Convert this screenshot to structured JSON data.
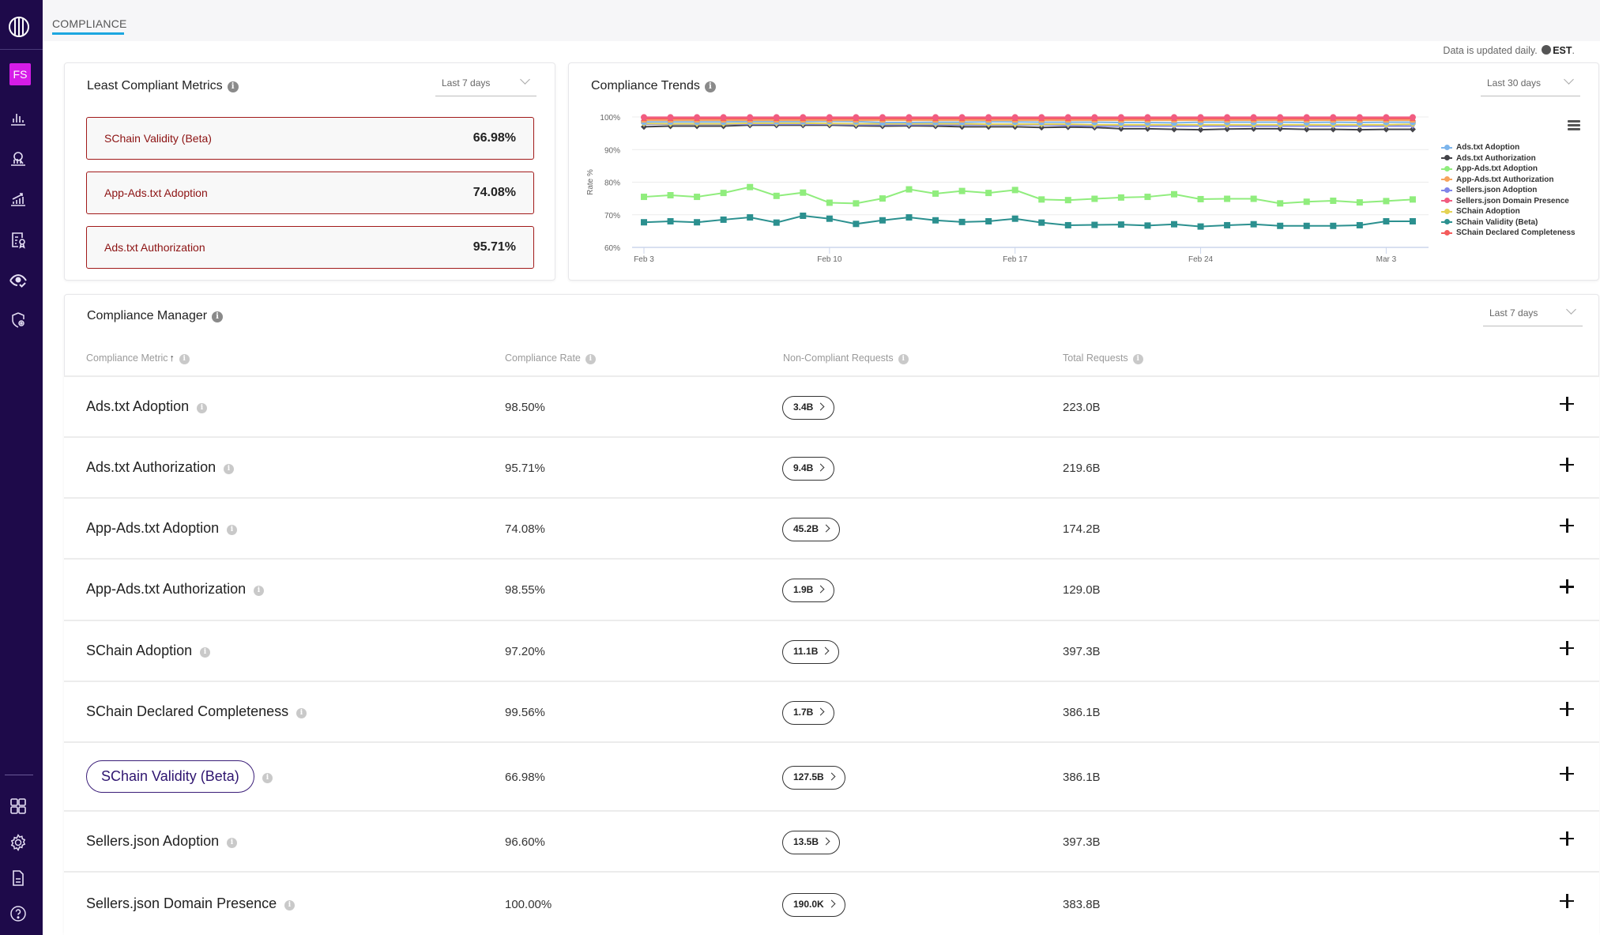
{
  "sidebar": {
    "avatar_initials": "FS",
    "items": [
      {
        "icon": "bar-chart-icon"
      },
      {
        "icon": "audience-icon"
      },
      {
        "icon": "growth-chart-icon"
      },
      {
        "icon": "certificate-icon"
      },
      {
        "icon": "eye-check-icon"
      },
      {
        "icon": "shield-gear-icon"
      }
    ],
    "bottom_items": [
      {
        "icon": "grid-icon"
      },
      {
        "icon": "gear-icon"
      },
      {
        "icon": "document-icon"
      },
      {
        "icon": "help-icon"
      }
    ]
  },
  "header": {
    "active_tab": "COMPLIANCE",
    "update_note_prefix": "Data is updated daily.",
    "timezone": "EST",
    "update_note_suffix": "."
  },
  "least_compliant": {
    "title": "Least Compliant Metrics",
    "range": "Last 7 days",
    "items": [
      {
        "name": "SChain Validity (Beta)",
        "value": "66.98%"
      },
      {
        "name": "App-Ads.txt Adoption",
        "value": "74.08%"
      },
      {
        "name": "Ads.txt Authorization",
        "value": "95.71%"
      }
    ]
  },
  "trends": {
    "title": "Compliance Trends",
    "range": "Last 30 days"
  },
  "chart_data": {
    "type": "line",
    "title": "Compliance Trends",
    "xlabel": "",
    "ylabel": "Rate %",
    "ylim": [
      60,
      100
    ],
    "yticks": [
      "60%",
      "70%",
      "80%",
      "90%",
      "100%"
    ],
    "xtick_labels": [
      {
        "index": 0,
        "label": "Feb 3"
      },
      {
        "index": 7,
        "label": "Feb 10"
      },
      {
        "index": 14,
        "label": "Feb 17"
      },
      {
        "index": 21,
        "label": "Feb 24"
      },
      {
        "index": 28,
        "label": "Mar 3"
      }
    ],
    "x": [
      "Feb 3",
      "Feb 4",
      "Feb 5",
      "Feb 6",
      "Feb 7",
      "Feb 8",
      "Feb 9",
      "Feb 10",
      "Feb 11",
      "Feb 12",
      "Feb 13",
      "Feb 14",
      "Feb 15",
      "Feb 16",
      "Feb 17",
      "Feb 18",
      "Feb 19",
      "Feb 20",
      "Feb 21",
      "Feb 22",
      "Feb 23",
      "Feb 24",
      "Feb 25",
      "Feb 26",
      "Feb 27",
      "Feb 28",
      "Mar 1",
      "Mar 2",
      "Mar 3",
      "Mar 4"
    ],
    "grid": true,
    "legend_position": "right",
    "series": [
      {
        "name": "Ads.txt Adoption",
        "color": "#7cb5ec",
        "marker": "circle",
        "values": [
          98.5,
          98.5,
          98.5,
          98.5,
          98.6,
          98.6,
          98.6,
          98.7,
          98.6,
          98.3,
          98.3,
          98.4,
          98.4,
          98.5,
          98.5,
          98.4,
          98.4,
          98.4,
          98.3,
          98.3,
          98.2,
          98.4,
          98.4,
          98.4,
          98.4,
          98.3,
          98.4,
          98.3,
          98.4,
          98.4
        ]
      },
      {
        "name": "Ads.txt Authorization",
        "color": "#434348",
        "marker": "diamond",
        "values": [
          97.0,
          97.2,
          97.2,
          97.2,
          97.5,
          97.5,
          97.5,
          97.5,
          97.3,
          97.2,
          97.3,
          97.2,
          97.0,
          97.0,
          97.0,
          96.8,
          96.9,
          96.8,
          96.4,
          96.4,
          96.2,
          96.1,
          96.3,
          96.4,
          96.4,
          96.2,
          96.2,
          96.1,
          96.2,
          96.2
        ]
      },
      {
        "name": "App-Ads.txt Adoption",
        "color": "#90ed7d",
        "marker": "square",
        "values": [
          75.5,
          76.0,
          75.5,
          76.7,
          78.5,
          75.8,
          76.8,
          73.7,
          73.5,
          75.0,
          77.8,
          76.5,
          77.3,
          76.7,
          77.6,
          74.7,
          74.5,
          74.9,
          75.3,
          75.5,
          76.3,
          74.8,
          74.9,
          74.9,
          73.5,
          74.0,
          74.3,
          73.8,
          74.2,
          74.7
        ]
      },
      {
        "name": "App-Ads.txt Authorization",
        "color": "#f7a35c",
        "marker": "triangle",
        "values": [
          99.0,
          99.0,
          99.0,
          99.0,
          99.0,
          99.0,
          99.0,
          99.0,
          99.0,
          99.0,
          99.0,
          99.0,
          99.0,
          99.0,
          99.0,
          99.0,
          99.0,
          99.0,
          99.0,
          99.0,
          99.0,
          99.0,
          99.0,
          99.0,
          99.0,
          99.0,
          99.0,
          99.0,
          99.0,
          99.0
        ]
      },
      {
        "name": "Sellers.json Adoption",
        "color": "#8085e9",
        "marker": "triangle-down",
        "values": [
          97.8,
          97.8,
          97.8,
          97.8,
          97.8,
          97.8,
          97.8,
          97.8,
          97.6,
          97.6,
          97.6,
          97.6,
          97.6,
          97.6,
          97.6,
          97.6,
          97.4,
          97.2,
          97.2,
          97.2,
          97.2,
          97.2,
          97.2,
          97.2,
          97.2,
          97.2,
          97.2,
          97.2,
          97.2,
          97.2
        ]
      },
      {
        "name": "Sellers.json Domain Presence",
        "color": "#f15c80",
        "marker": "circle",
        "values": [
          99.9,
          99.9,
          99.9,
          99.9,
          99.9,
          99.9,
          99.9,
          99.9,
          99.9,
          99.9,
          99.9,
          99.9,
          99.9,
          99.9,
          99.9,
          99.9,
          99.9,
          99.9,
          99.9,
          99.9,
          99.9,
          99.9,
          99.9,
          99.9,
          99.9,
          99.9,
          99.9,
          99.9,
          99.9,
          99.9
        ]
      },
      {
        "name": "SChain Adoption",
        "color": "#e4d354",
        "marker": "diamond",
        "values": [
          98.0,
          97.9,
          97.9,
          97.9,
          98.1,
          98.1,
          98.1,
          98.0,
          97.9,
          97.9,
          97.9,
          97.9,
          97.9,
          97.8,
          97.8,
          97.8,
          97.8,
          97.6,
          97.6,
          97.6,
          97.6,
          97.6,
          97.6,
          97.6,
          97.6,
          97.6,
          97.6,
          97.6,
          97.6,
          97.8
        ]
      },
      {
        "name": "SChain Validity (Beta)",
        "color": "#2b908f",
        "marker": "square",
        "values": [
          67.7,
          68.0,
          67.7,
          68.5,
          69.2,
          67.6,
          69.7,
          68.8,
          67.2,
          68.3,
          69.2,
          68.3,
          67.8,
          68.0,
          68.8,
          67.6,
          66.8,
          66.9,
          67.0,
          66.7,
          67.1,
          66.4,
          66.8,
          67.1,
          66.6,
          66.6,
          66.6,
          66.8,
          68.0,
          68.0
        ]
      },
      {
        "name": "SChain Declared Completeness",
        "color": "#f45b5b",
        "marker": "triangle",
        "values": [
          99.5,
          99.5,
          99.5,
          99.5,
          99.5,
          99.5,
          99.5,
          99.5,
          99.5,
          99.5,
          99.5,
          99.5,
          99.5,
          99.5,
          99.5,
          99.5,
          99.5,
          99.5,
          99.5,
          99.5,
          99.5,
          99.5,
          99.5,
          99.5,
          99.5,
          99.5,
          99.5,
          99.5,
          99.5,
          99.5
        ]
      }
    ]
  },
  "manager": {
    "title": "Compliance Manager",
    "range": "Last 7 days",
    "columns": {
      "metric": "Compliance Metric",
      "rate": "Compliance Rate",
      "non_compliant": "Non-Compliant Requests",
      "total": "Total Requests"
    },
    "rows": [
      {
        "metric": "Ads.txt Adoption",
        "rate": "98.50%",
        "non_compliant": "3.4B",
        "total": "223.0B"
      },
      {
        "metric": "Ads.txt Authorization",
        "rate": "95.71%",
        "non_compliant": "9.4B",
        "total": "219.6B"
      },
      {
        "metric": "App-Ads.txt Adoption",
        "rate": "74.08%",
        "non_compliant": "45.2B",
        "total": "174.2B"
      },
      {
        "metric": "App-Ads.txt Authorization",
        "rate": "98.55%",
        "non_compliant": "1.9B",
        "total": "129.0B"
      },
      {
        "metric": "SChain Adoption",
        "rate": "97.20%",
        "non_compliant": "11.1B",
        "total": "397.3B"
      },
      {
        "metric": "SChain Declared Completeness",
        "rate": "99.56%",
        "non_compliant": "1.7B",
        "total": "386.1B"
      },
      {
        "metric": "SChain Validity (Beta)",
        "rate": "66.98%",
        "non_compliant": "127.5B",
        "total": "386.1B",
        "selected": true
      },
      {
        "metric": "Sellers.json Adoption",
        "rate": "96.60%",
        "non_compliant": "13.5B",
        "total": "397.3B"
      },
      {
        "metric": "Sellers.json Domain Presence",
        "rate": "100.00%",
        "non_compliant": "190.0K",
        "total": "383.8B"
      }
    ]
  }
}
